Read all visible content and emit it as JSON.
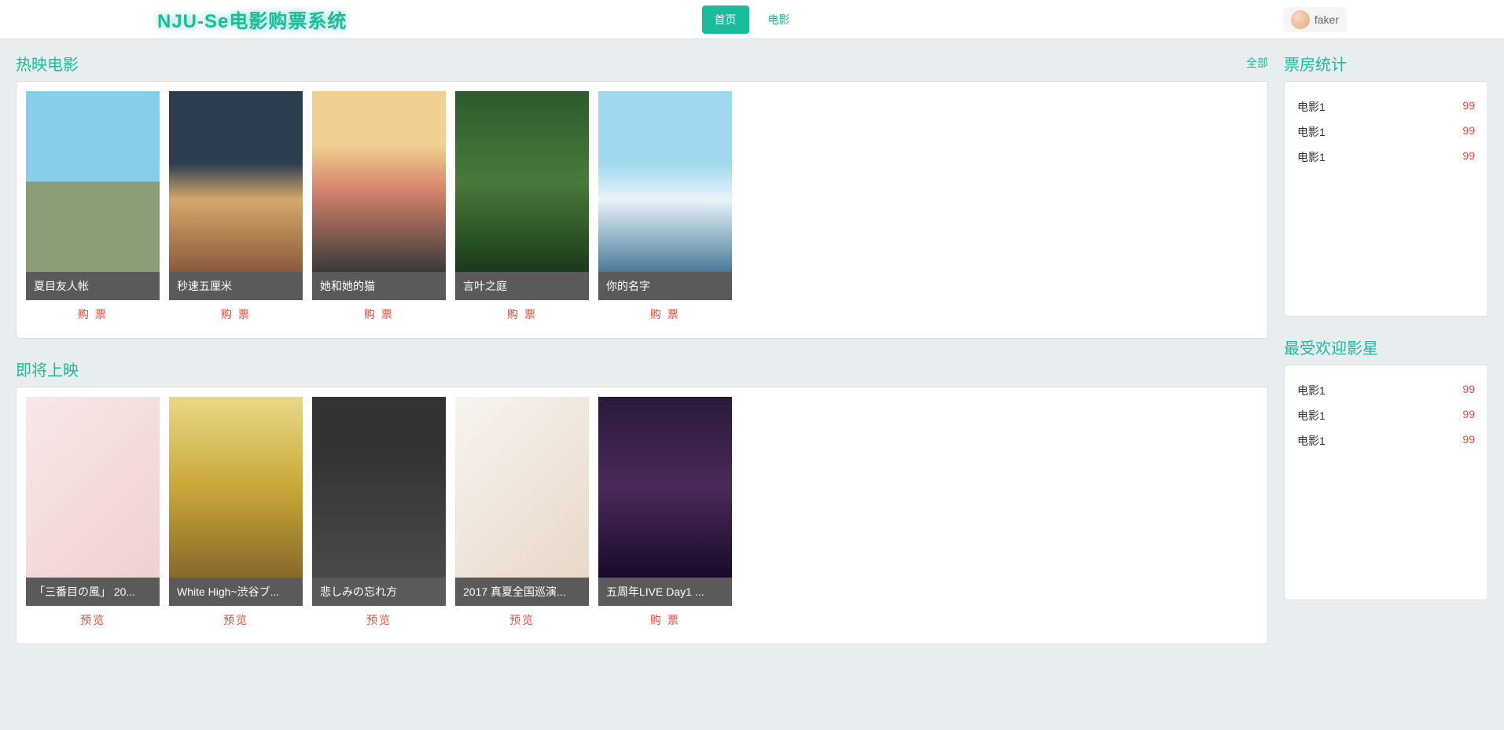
{
  "nav": {
    "brand": "NJU-Se电影购票系统",
    "home": "首页",
    "movie": "电影",
    "username": "faker"
  },
  "sections": {
    "nowShowing": {
      "title": "热映电影",
      "allLabel": "全部",
      "movies": [
        {
          "title": "夏目友人帐",
          "action": "购 票"
        },
        {
          "title": "秒速五厘米",
          "action": "购 票"
        },
        {
          "title": "她和她的猫",
          "action": "购 票"
        },
        {
          "title": "言叶之庭",
          "action": "购 票"
        },
        {
          "title": "你的名字",
          "action": "购 票"
        }
      ]
    },
    "comingSoon": {
      "title": "即将上映",
      "movies": [
        {
          "title": "「三番目の風」 20...",
          "action": "预览"
        },
        {
          "title": "White High~渋谷ブ...",
          "action": "预览"
        },
        {
          "title": "悲しみの忘れ方",
          "action": "预览"
        },
        {
          "title": "2017 真夏全国巡演...",
          "action": "预览"
        },
        {
          "title": "五周年LIVE Day1 ...",
          "action": "购 票"
        }
      ]
    }
  },
  "sidebar": {
    "boxOffice": {
      "title": "票房统计",
      "rows": [
        {
          "name": "电影1",
          "value": "99"
        },
        {
          "name": "电影1",
          "value": "99"
        },
        {
          "name": "电影1",
          "value": "99"
        }
      ]
    },
    "popularStars": {
      "title": "最受欢迎影星",
      "rows": [
        {
          "name": "电影1",
          "value": "99"
        },
        {
          "name": "电影1",
          "value": "99"
        },
        {
          "name": "电影1",
          "value": "99"
        }
      ]
    }
  }
}
